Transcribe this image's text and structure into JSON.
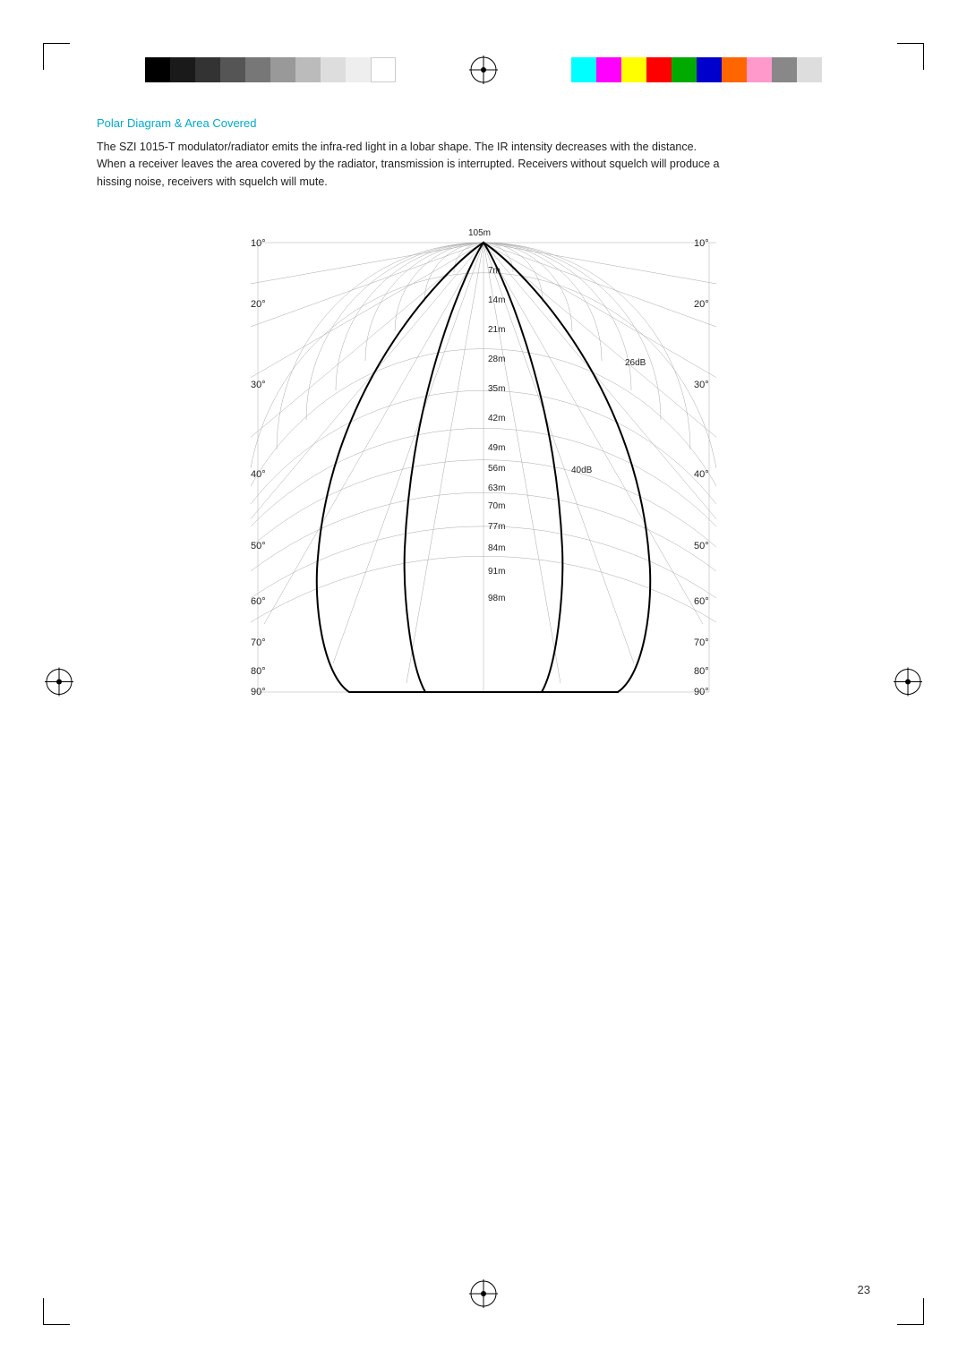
{
  "page": {
    "number": "23",
    "title": "Polar Diagram & Area Covered",
    "body_text": "The SZI 1015-T modulator/radiator emits the infra-red light in a lobar shape. The IR intensity decreases with the distance. When a receiver leaves the area covered by the radiator, transmission is interrupted. Receivers without squelch will produce a hissing noise, receivers with squelch will mute.",
    "color_bars_left": [
      "#000",
      "#1a1a1a",
      "#333",
      "#555",
      "#777",
      "#999",
      "#bbb",
      "#ddd",
      "#fff",
      "#eee"
    ],
    "color_bars_right": [
      "#00FFFF",
      "#FF00FF",
      "#FFFF00",
      "#FF0000",
      "#00FF00",
      "#0000FF",
      "#FF6600",
      "#FF99CC"
    ],
    "diagram": {
      "angles_left": [
        "10°",
        "20°",
        "30°",
        "40°",
        "50°",
        "60°",
        "70°",
        "80°",
        "90°"
      ],
      "angles_right": [
        "10°",
        "20°",
        "30°",
        "40°",
        "50°",
        "60°",
        "70°",
        "80°",
        "90°"
      ],
      "distances": [
        "105m",
        "98m",
        "91m",
        "84m",
        "77m",
        "70m",
        "63m",
        "56m",
        "49m",
        "42m",
        "35m",
        "28m",
        "21m",
        "14m",
        "7m"
      ],
      "labels": [
        "26dB",
        "40dB"
      ]
    }
  }
}
